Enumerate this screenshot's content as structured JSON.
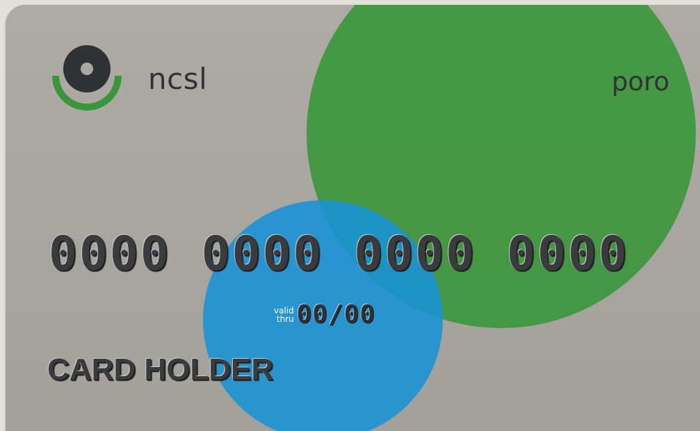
{
  "card": {
    "brand": "ncsl",
    "product": "poro",
    "number": "0000 0000 0000 0000",
    "valid_label_line1": "valid",
    "valid_label_line2": "thru",
    "expiry": "00/00",
    "holder": "CARD HOLDER"
  },
  "colors": {
    "card_background": "#aba8a3",
    "green_circle": "#3a963a",
    "blue_circle": "#1793d6",
    "logo_dark": "#2f3336",
    "logo_green": "#3a963a"
  },
  "icons": {
    "logo": "ncsl-logo-icon"
  }
}
